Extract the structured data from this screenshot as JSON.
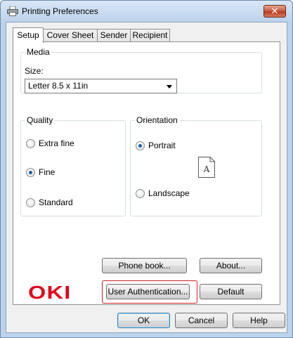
{
  "window": {
    "title": "Printing Preferences",
    "close_glyph": "✕",
    "title_icon": "printer-icon"
  },
  "tabs": [
    {
      "label": "Setup",
      "active": true
    },
    {
      "label": "Cover Sheet",
      "active": false
    },
    {
      "label": "Sender",
      "active": false
    },
    {
      "label": "Recipient",
      "active": false
    }
  ],
  "media": {
    "group_label": "Media",
    "size_label": "Size:",
    "size_value": "Letter 8.5 x 11in"
  },
  "quality": {
    "group_label": "Quality",
    "options": [
      {
        "label": "Extra fine",
        "checked": false
      },
      {
        "label": "Fine",
        "checked": true
      },
      {
        "label": "Standard",
        "checked": false
      }
    ]
  },
  "orientation": {
    "group_label": "Orientation",
    "options": [
      {
        "label": "Portrait",
        "checked": true
      },
      {
        "label": "Landscape",
        "checked": false
      }
    ],
    "preview_letter": "A"
  },
  "buttons": {
    "phone_book": "Phone book...",
    "about": "About...",
    "user_auth": "User Authentication...",
    "default": "Default",
    "ok": "OK",
    "cancel": "Cancel",
    "help": "Help"
  },
  "brand": {
    "logo_text": "OKI",
    "logo_color": "#e0001b",
    "highlight_color": "#d0202a"
  }
}
